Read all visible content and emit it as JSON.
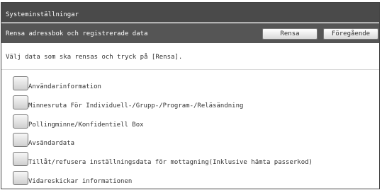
{
  "window": {
    "title": "Systeminställningar"
  },
  "subheader": {
    "title": "Rensa adressbok och registrerade data",
    "clear_label": "Rensa",
    "back_label": "Föregående"
  },
  "instruction": "Välj data som ska rensas och tryck på [Rensa].",
  "options": [
    {
      "label": "Användarinformation",
      "checked": false
    },
    {
      "label": "Minnesruta För Individuell-/Grupp-/Program-/Reläsändning",
      "checked": false
    },
    {
      "label": "Pollingminne/Konfidentiell Box",
      "checked": false
    },
    {
      "label": "Avsändardata",
      "checked": false
    },
    {
      "label": "Tillåt/refusera inställningsdata för mottagning(Inklusive hämta passerkod)",
      "checked": false
    },
    {
      "label": "Vidareskickar informationen",
      "checked": false
    }
  ]
}
